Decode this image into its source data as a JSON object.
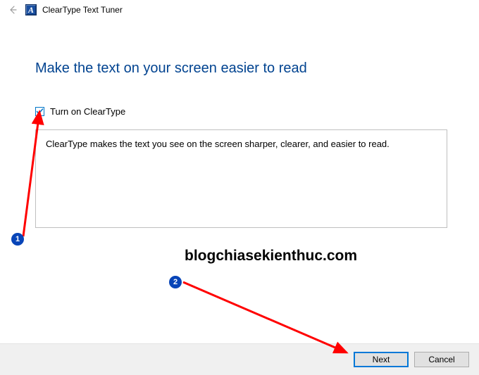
{
  "window": {
    "title": "ClearType Text Tuner",
    "app_icon_letter": "A"
  },
  "main": {
    "heading": "Make the text on your screen easier to read",
    "checkbox_label": "Turn on ClearType",
    "description": "ClearType makes the text you see on the screen sharper, clearer, and easier to read."
  },
  "footer": {
    "next_label": "Next",
    "cancel_label": "Cancel"
  },
  "annotations": {
    "badge1": "1",
    "badge2": "2",
    "watermark": "blogchiasekienthuc.com"
  }
}
